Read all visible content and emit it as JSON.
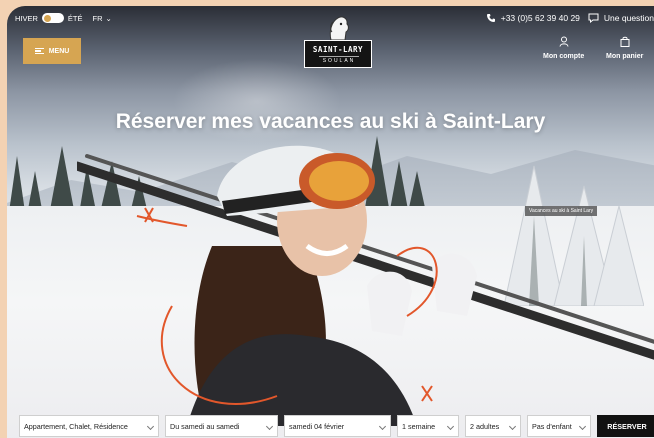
{
  "topbar": {
    "season_winter": "HIVER",
    "season_summer": "ÉTÉ",
    "language": "FR",
    "phone": "+33 (0)5 62 39 40 29",
    "question": "Une question"
  },
  "menu": {
    "label": "MENU"
  },
  "logo": {
    "main": "SAINT-LARY",
    "sub": "SOULAN"
  },
  "account": {
    "my_account": "Mon compte",
    "my_cart": "Mon panier"
  },
  "hero": {
    "title": "Réserver mes vacances au ski à Saint-Lary",
    "caption": "Vacances au ski à Saint Lary"
  },
  "booking": {
    "accommodation": "Appartement, Chalet, Résidence",
    "period": "Du samedi au samedi",
    "date": "samedi 04 février",
    "duration": "1 semaine",
    "adults": "2 adultes",
    "children": "Pas d'enfant",
    "submit": "RÉSERVER"
  },
  "colors": {
    "accent": "#d6a552",
    "dark": "#111111",
    "frame_bg": "#f3d2b3"
  }
}
